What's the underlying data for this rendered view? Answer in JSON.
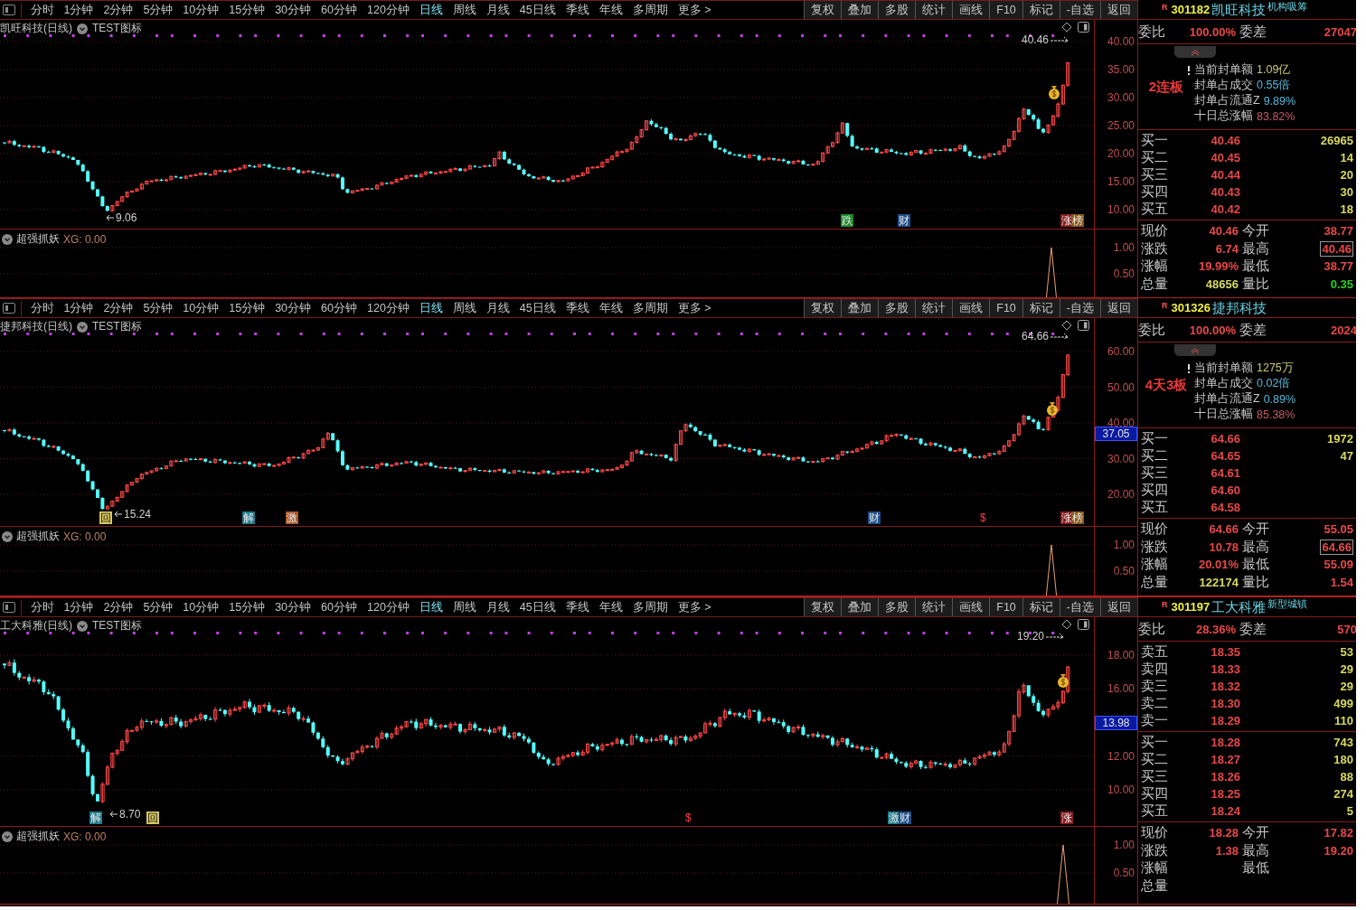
{
  "panes": [
    {
      "toolbar": {
        "periods": [
          {
            "label": "分时",
            "selected": false
          },
          {
            "label": "1分钟",
            "selected": false
          },
          {
            "label": "2分钟",
            "selected": false
          },
          {
            "label": "5分钟",
            "selected": false
          },
          {
            "label": "10分钟",
            "selected": false
          },
          {
            "label": "15分钟",
            "selected": false
          },
          {
            "label": "30分钟",
            "selected": false
          },
          {
            "label": "60分钟",
            "selected": false
          },
          {
            "label": "120分钟",
            "selected": false
          },
          {
            "label": "日线",
            "selected": true
          },
          {
            "label": "周线",
            "selected": false
          },
          {
            "label": "月线",
            "selected": false
          },
          {
            "label": "45日线",
            "selected": false
          },
          {
            "label": "季线",
            "selected": false
          },
          {
            "label": "年线",
            "selected": false
          },
          {
            "label": "多周期",
            "selected": false
          },
          {
            "label": "更多 >",
            "selected": false
          }
        ],
        "buttons": [
          "复权",
          "叠加",
          "多股",
          "统计",
          "画线",
          "F10",
          "标记",
          "-自选",
          "返回"
        ]
      },
      "chart": {
        "title": "凯旺科技(日线)",
        "overlay": "TEST图标",
        "y_ticks": [
          "40.00",
          "35.00",
          "30.00",
          "25.00",
          "20.00",
          "15.00",
          "10.00"
        ],
        "low_label": "9.06",
        "high_label": "40.46",
        "tags": [
          {
            "text": "跌",
            "color": "#1f8a2a"
          },
          {
            "text": "财",
            "color": "#1d4f8a"
          },
          {
            "text": "涨",
            "color": "#8a1a1a"
          },
          {
            "text": "榜",
            "color": "#8a5a1a"
          }
        ]
      },
      "indicator": {
        "name": "超强抓妖",
        "reading": "XG: 0.00",
        "y_ticks": [
          "1.00",
          "0.50"
        ]
      },
      "quote": {
        "flag": "R",
        "code": "301182",
        "name": "凯旺科技",
        "concept": "机构吸筹",
        "ratio_label": "委比",
        "ratio": "100.00%",
        "diff_label": "委差",
        "diff": "27047",
        "board": {
          "label": "2连板",
          "info": [
            {
              "label": "当前封单额",
              "value": "1.09亿",
              "color": "#c8c878"
            },
            {
              "label": "封单占成交",
              "value": "0.55倍",
              "color": "#5ab8d8"
            },
            {
              "label": "封单占流通Z",
              "value": "9.89%",
              "color": "#5ab8d8"
            },
            {
              "label": "十日总涨幅",
              "value": "83.82%",
              "color": "#c85a6a"
            }
          ]
        },
        "buys": [
          {
            "label": "买一",
            "price": "40.46",
            "volume": "26965"
          },
          {
            "label": "买二",
            "price": "40.45",
            "volume": "14"
          },
          {
            "label": "买三",
            "price": "40.44",
            "volume": "20"
          },
          {
            "label": "买四",
            "price": "40.43",
            "volume": "30"
          },
          {
            "label": "买五",
            "price": "40.42",
            "volume": "18"
          }
        ],
        "stats": [
          {
            "label": "现价",
            "value": "40.46",
            "color": "#e84848",
            "boxed": false
          },
          {
            "label": "今开",
            "value": "38.77",
            "color": "#e84848",
            "boxed": false
          },
          {
            "label": "涨跌",
            "value": "6.74",
            "color": "#e84848",
            "boxed": false
          },
          {
            "label": "最高",
            "value": "40.46",
            "color": "#e84848",
            "boxed": true
          },
          {
            "label": "涨幅",
            "value": "19.99%",
            "color": "#e84848",
            "boxed": false
          },
          {
            "label": "最低",
            "value": "38.77",
            "color": "#e84848",
            "boxed": false
          },
          {
            "label": "总量",
            "value": "48656",
            "color": "#d8d860",
            "boxed": false
          },
          {
            "label": "量比",
            "value": "0.35",
            "color": "#22d022",
            "boxed": false
          }
        ]
      }
    },
    {
      "toolbar": {
        "periods": [
          {
            "label": "分时",
            "selected": false
          },
          {
            "label": "1分钟",
            "selected": false
          },
          {
            "label": "2分钟",
            "selected": false
          },
          {
            "label": "5分钟",
            "selected": false
          },
          {
            "label": "10分钟",
            "selected": false
          },
          {
            "label": "15分钟",
            "selected": false
          },
          {
            "label": "30分钟",
            "selected": false
          },
          {
            "label": "60分钟",
            "selected": false
          },
          {
            "label": "120分钟",
            "selected": false
          },
          {
            "label": "日线",
            "selected": true
          },
          {
            "label": "周线",
            "selected": false
          },
          {
            "label": "月线",
            "selected": false
          },
          {
            "label": "45日线",
            "selected": false
          },
          {
            "label": "季线",
            "selected": false
          },
          {
            "label": "年线",
            "selected": false
          },
          {
            "label": "多周期",
            "selected": false
          },
          {
            "label": "更多 >",
            "selected": false
          }
        ],
        "buttons": [
          "复权",
          "叠加",
          "多股",
          "统计",
          "画线",
          "F10",
          "标记",
          "-自选",
          "返回"
        ]
      },
      "chart": {
        "title": "捷邦科技(日线)",
        "overlay": "TEST图标",
        "y_ticks": [
          "60.00",
          "50.00",
          "40.00",
          "30.00",
          "20.00"
        ],
        "low_label": "15.24",
        "high_label": "64.66",
        "axis_marker": "37.05",
        "tags": [
          {
            "text": "回",
            "color": "#d8c860"
          },
          {
            "text": "解",
            "color": "#1f7a8a"
          },
          {
            "text": "激",
            "color": "#a8582a"
          },
          {
            "text": "财",
            "color": "#1d4f8a"
          },
          {
            "text": "$",
            "color": "#000000"
          },
          {
            "text": "涨",
            "color": "#8a1a1a"
          },
          {
            "text": "榜",
            "color": "#8a5a1a"
          }
        ]
      },
      "indicator": {
        "name": "超强抓妖",
        "reading": "XG: 0.00",
        "y_ticks": [
          "1.00",
          "0.50"
        ]
      },
      "quote": {
        "flag": "R",
        "code": "301326",
        "name": "捷邦科技",
        "ratio_label": "委比",
        "ratio": "100.00%",
        "diff_label": "委差",
        "diff": "2024",
        "board": {
          "label": "4天3板",
          "info": [
            {
              "label": "当前封单额",
              "value": "1275万",
              "color": "#c8c878"
            },
            {
              "label": "封单占成交",
              "value": "0.02倍",
              "color": "#5ab8d8"
            },
            {
              "label": "封单占流通Z",
              "value": "0.89%",
              "color": "#5ab8d8"
            },
            {
              "label": "十日总涨幅",
              "value": "85.38%",
              "color": "#c85a6a"
            }
          ]
        },
        "buys": [
          {
            "label": "买一",
            "price": "64.66",
            "volume": "1972"
          },
          {
            "label": "买二",
            "price": "64.65",
            "volume": "47"
          },
          {
            "label": "买三",
            "price": "64.61"
          },
          {
            "label": "买四",
            "price": "64.60"
          },
          {
            "label": "买五",
            "price": "64.58"
          }
        ],
        "stats": [
          {
            "label": "现价",
            "value": "64.66",
            "color": "#e84848",
            "boxed": false
          },
          {
            "label": "今开",
            "value": "55.05",
            "color": "#e84848",
            "boxed": false
          },
          {
            "label": "涨跌",
            "value": "10.78",
            "color": "#e84848",
            "boxed": false
          },
          {
            "label": "最高",
            "value": "64.66",
            "color": "#e84848",
            "boxed": true
          },
          {
            "label": "涨幅",
            "value": "20.01%",
            "color": "#e84848",
            "boxed": false
          },
          {
            "label": "最低",
            "value": "55.09",
            "color": "#e84848",
            "boxed": false
          },
          {
            "label": "总量",
            "value": "122174",
            "color": "#d8d860",
            "boxed": false
          },
          {
            "label": "量比",
            "value": "1.54",
            "color": "#e84848",
            "boxed": false
          }
        ]
      }
    },
    {
      "toolbar": {
        "periods": [
          {
            "label": "分时",
            "selected": false
          },
          {
            "label": "1分钟",
            "selected": false
          },
          {
            "label": "2分钟",
            "selected": false
          },
          {
            "label": "5分钟",
            "selected": false
          },
          {
            "label": "10分钟",
            "selected": false
          },
          {
            "label": "15分钟",
            "selected": false
          },
          {
            "label": "30分钟",
            "selected": false
          },
          {
            "label": "60分钟",
            "selected": false
          },
          {
            "label": "120分钟",
            "selected": false
          },
          {
            "label": "日线",
            "selected": true
          },
          {
            "label": "周线",
            "selected": false
          },
          {
            "label": "月线",
            "selected": false
          },
          {
            "label": "45日线",
            "selected": false
          },
          {
            "label": "季线",
            "selected": false
          },
          {
            "label": "年线",
            "selected": false
          },
          {
            "label": "多周期",
            "selected": false
          },
          {
            "label": "更多 >",
            "selected": false
          }
        ],
        "buttons": [
          "复权",
          "叠加",
          "多股",
          "统计",
          "画线",
          "F10",
          "标记",
          "-自选",
          "返回"
        ]
      },
      "chart": {
        "title": "工大科雅(日线)",
        "overlay": "TEST图标",
        "y_ticks": [
          "18.00",
          "16.00",
          "12.00",
          "10.00"
        ],
        "low_label": "8.70",
        "high_label": "19.20",
        "axis_marker": "13.98",
        "tags": [
          {
            "text": "解",
            "color": "#1f7a8a"
          },
          {
            "text": "回",
            "color": "#d8c860"
          },
          {
            "text": "$",
            "color": "#000000"
          },
          {
            "text": "激",
            "color": "#1f7a8a"
          },
          {
            "text": "财",
            "color": "#1d4f8a"
          },
          {
            "text": "涨",
            "color": "#8a1a1a"
          }
        ]
      },
      "indicator": {
        "name": "超强抓妖",
        "reading": "XG: 0.00",
        "y_ticks": [
          "1.00",
          "0.50"
        ]
      },
      "quote": {
        "flag": "R",
        "code": "301197",
        "name": "工大科雅",
        "concept": "新型城镇",
        "ratio_label": "委比",
        "ratio": "28.36%",
        "diff_label": "委差",
        "diff": "570",
        "sells": [
          {
            "label": "卖五",
            "price": "18.35",
            "volume": "53"
          },
          {
            "label": "卖四",
            "price": "18.33",
            "volume": "29"
          },
          {
            "label": "卖三",
            "price": "18.32",
            "volume": "29"
          },
          {
            "label": "卖二",
            "price": "18.30",
            "volume": "499"
          },
          {
            "label": "卖一",
            "price": "18.29",
            "volume": "110"
          }
        ],
        "buys": [
          {
            "label": "买一",
            "price": "18.28",
            "volume": "743"
          },
          {
            "label": "买二",
            "price": "18.27",
            "volume": "180"
          },
          {
            "label": "买三",
            "price": "18.26",
            "volume": "88"
          },
          {
            "label": "买四",
            "price": "18.25",
            "volume": "274"
          },
          {
            "label": "买五",
            "price": "18.24",
            "volume": "5"
          }
        ],
        "stats": [
          {
            "label": "现价",
            "value": "18.28",
            "color": "#e84848",
            "boxed": false
          },
          {
            "label": "今开",
            "value": "17.82",
            "color": "#e84848",
            "boxed": false
          },
          {
            "label": "涨跌",
            "value": "1.38",
            "color": "#e84848",
            "boxed": false
          },
          {
            "label": "最高",
            "value": "19.20",
            "color": "#e84848",
            "boxed": false
          },
          {
            "label": "涨幅"
          },
          {
            "label": "最低"
          },
          {
            "label": "总量"
          }
        ]
      }
    }
  ]
}
